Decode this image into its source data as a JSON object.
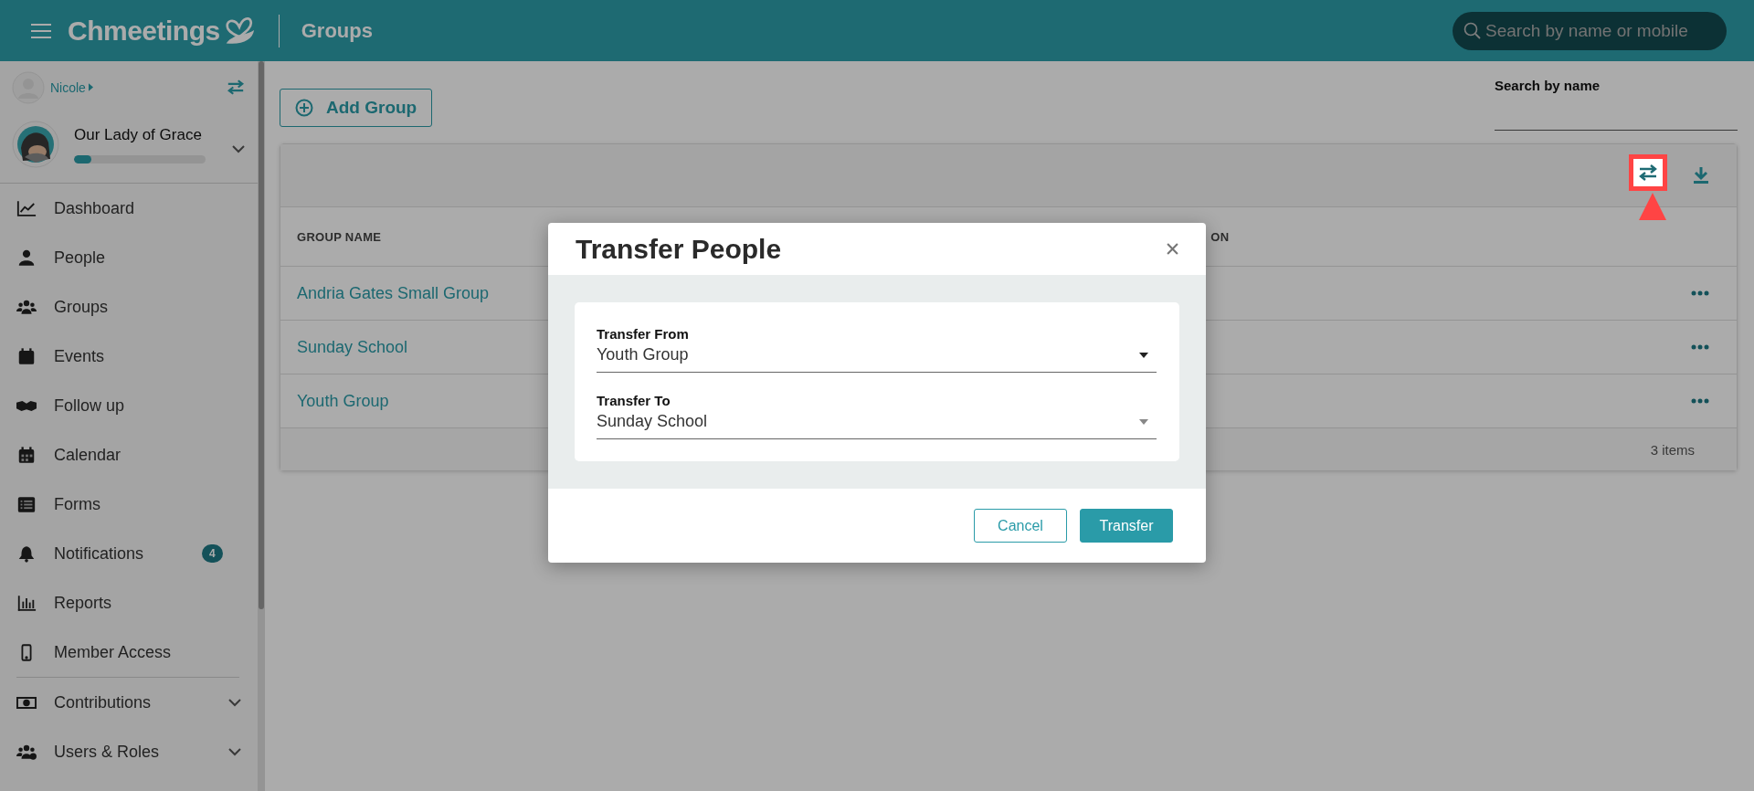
{
  "topbar": {
    "logo": "Chmeetings",
    "page_title": "Groups",
    "search": {
      "placeholder": "Search by name or mobile"
    }
  },
  "sidebar": {
    "user": {
      "name": "Nicole"
    },
    "organization": {
      "name": "Our Lady of Grace",
      "level": 0.13
    },
    "items": [
      {
        "label": "Dashboard",
        "kind": "link"
      },
      {
        "label": "People",
        "kind": "link"
      },
      {
        "label": "Groups",
        "kind": "link"
      },
      {
        "label": "Events",
        "kind": "link"
      },
      {
        "label": "Follow up",
        "kind": "link"
      },
      {
        "label": "Calendar",
        "kind": "link"
      },
      {
        "label": "Forms",
        "kind": "link"
      },
      {
        "label": "Notifications",
        "kind": "link",
        "badge": "4"
      },
      {
        "label": "Reports",
        "kind": "link"
      },
      {
        "label": "Member Access",
        "kind": "link"
      },
      {
        "label": "Contributions",
        "kind": "expandable"
      },
      {
        "label": "Users & Roles",
        "kind": "expandable"
      }
    ]
  },
  "add_group_button": "Add Group",
  "search_by_name": {
    "label": "Search by name"
  },
  "table": {
    "columns": [
      "GROUP NAME",
      "ON"
    ],
    "rows": [
      {
        "group_name": "Andria Gates Small Group"
      },
      {
        "group_name": "Sunday School"
      },
      {
        "group_name": "Youth Group"
      }
    ],
    "footer": "3 items"
  },
  "dialog": {
    "title": "Transfer People",
    "fields": [
      {
        "label": "Transfer From",
        "value": "Youth Group",
        "disabled": false
      },
      {
        "label": "Transfer To",
        "value": "Sunday School",
        "disabled": true
      }
    ],
    "buttons": [
      {
        "label": "Cancel",
        "kind": "secondary"
      },
      {
        "label": "Transfer",
        "kind": "primary"
      }
    ]
  }
}
